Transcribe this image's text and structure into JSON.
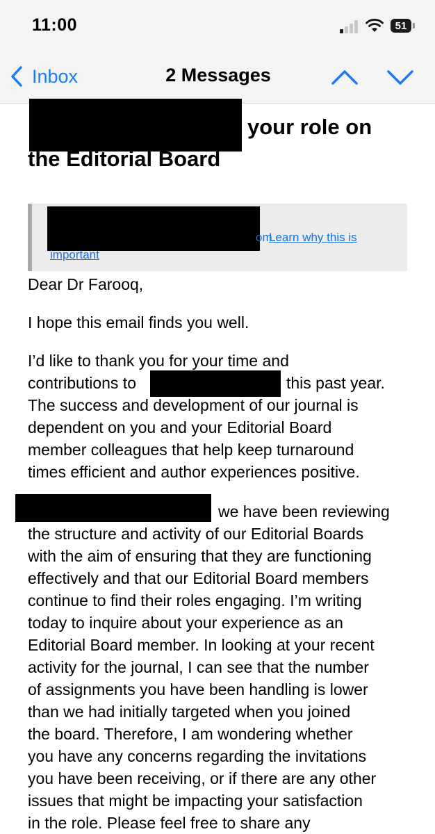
{
  "status_bar": {
    "time": "11:00",
    "battery_level": "51"
  },
  "nav": {
    "back_label": "Inbox",
    "title": "2 Messages"
  },
  "subject": {
    "line1_visible": "your role on",
    "line2": "the Editorial Board"
  },
  "notice": {
    "domain_end": "om.",
    "link_part1": "Learn why this is",
    "link_part2": "important"
  },
  "body": {
    "greeting": "Dear Dr Farooq,",
    "p1": "I hope this email finds you well.",
    "p2": [
      "I’d like to thank you for your time and",
      "this past year.",
      "The success and development of our journal is",
      "dependent on you and your Editorial Board",
      "member colleagues that help keep turnaround",
      "times efficient and author experiences positive."
    ],
    "p2_line2_start": "contributions to",
    "p3_first": "we have been reviewing",
    "p3": [
      "the structure and activity of our Editorial Boards",
      "with the aim of ensuring that they are functioning",
      "effectively and that our Editorial Board members",
      "continue to find their roles engaging. I’m writing",
      "today to inquire about your experience as an",
      "Editorial Board member. In looking at your recent",
      "activity for the journal, I can see that the number",
      "of assignments you have been handling is lower",
      "than we had initially targeted when you joined",
      "the board. Therefore, I am wondering whether",
      "you have any concerns regarding the invitations",
      "you have been receiving, or if there are any other",
      "issues that might be impacting your satisfaction",
      "in the role. Please feel free to share any"
    ]
  },
  "colors": {
    "accent": "#1a7cf5",
    "chrome_bg": "#f4f4f5",
    "notice_bg": "#ececee",
    "redaction": "#000000"
  }
}
